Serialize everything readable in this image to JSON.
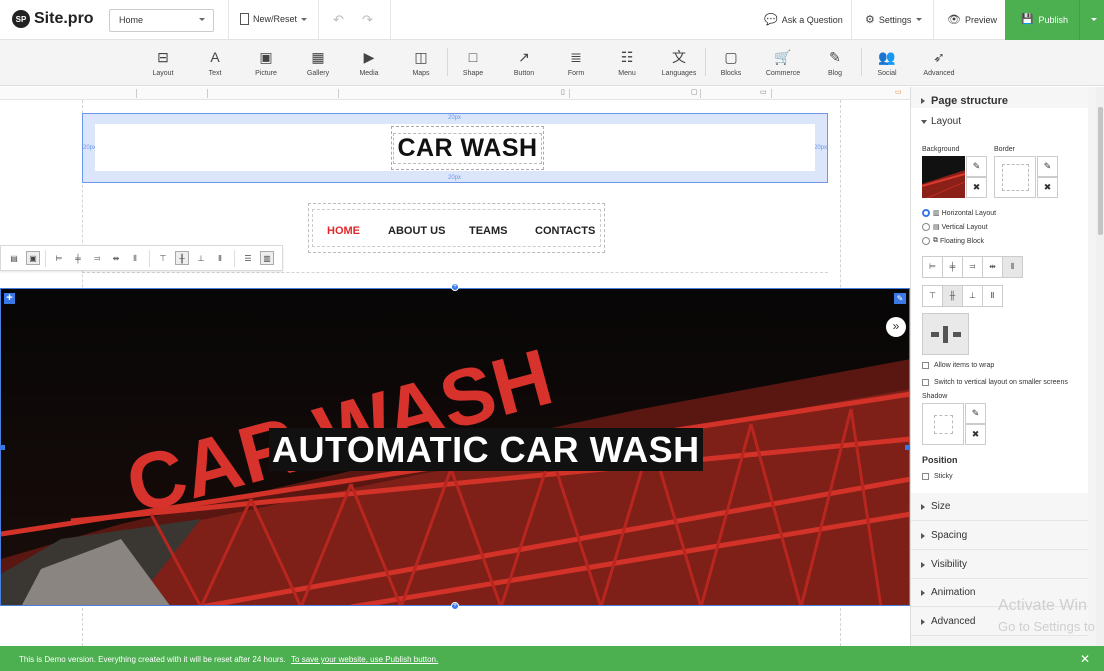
{
  "topbar": {
    "logo_badge": "SP",
    "logo_text": "Site.pro",
    "page_select_value": "Home",
    "new_reset_label": "New/Reset",
    "ask_question_label": "Ask a Question",
    "settings_label": "Settings",
    "preview_label": "Preview",
    "publish_label": "Publish"
  },
  "tools": [
    {
      "label": "Layout",
      "icon": "layout-icon",
      "glyph": "⊟"
    },
    {
      "label": "Text",
      "icon": "text-icon",
      "glyph": "A"
    },
    {
      "label": "Picture",
      "icon": "picture-icon",
      "glyph": "▣"
    },
    {
      "label": "Gallery",
      "icon": "gallery-icon",
      "glyph": "▦"
    },
    {
      "label": "Media",
      "icon": "media-icon",
      "glyph": "▶"
    },
    {
      "label": "Maps",
      "icon": "maps-icon",
      "glyph": "◫"
    },
    {
      "label": "Shape",
      "icon": "shape-icon",
      "glyph": "□"
    },
    {
      "label": "Button",
      "icon": "button-icon",
      "glyph": "↗"
    },
    {
      "label": "Form",
      "icon": "form-icon",
      "glyph": "≣"
    },
    {
      "label": "Menu",
      "icon": "menu-icon",
      "glyph": "☷"
    },
    {
      "label": "Languages",
      "icon": "languages-icon",
      "glyph": "文"
    },
    {
      "label": "Blocks",
      "icon": "blocks-icon",
      "glyph": "▢"
    },
    {
      "label": "Commerce",
      "icon": "commerce-icon",
      "glyph": "🛒"
    },
    {
      "label": "Blog",
      "icon": "blog-icon",
      "glyph": "✎"
    },
    {
      "label": "Social",
      "icon": "social-icon",
      "glyph": "👥"
    },
    {
      "label": "Advanced",
      "icon": "advanced-icon",
      "glyph": "➶"
    }
  ],
  "canvas": {
    "header_title": "CAR WASH",
    "padding_label": "20px",
    "nav_items": [
      "HOME",
      "ABOUT US",
      "TEAMS",
      "CONTACTS"
    ],
    "active_nav": "HOME",
    "hero_title": "AUTOMATIC CAR WASH",
    "hero_sign_text": "CAR WASH"
  },
  "panel": {
    "page_structure": "Page structure",
    "layout": "Layout",
    "background_label": "Background",
    "border_label": "Border",
    "radio_options": [
      "Horizontal Layout",
      "Vertical Layout",
      "Floating Block"
    ],
    "selected_layout": "Horizontal Layout",
    "allow_wrap": "Allow items to wrap",
    "switch_vertical": "Switch to vertical layout on smaller screens",
    "shadow_label": "Shadow",
    "position_label": "Position",
    "sticky_label": "Sticky",
    "sections": [
      "Size",
      "Spacing",
      "Visibility",
      "Animation",
      "Advanced"
    ]
  },
  "watermark": {
    "line1": "Activate Win",
    "line2": "Go to Settings to"
  },
  "demobar": {
    "text": "This is Demo version. Everything created with it will be reset after 24 hours.",
    "link": "To save your website, use Publish button."
  },
  "colors": {
    "accent_blue": "#3b78e7",
    "publish_green": "#4caf50",
    "nav_active_red": "#e0282e"
  }
}
